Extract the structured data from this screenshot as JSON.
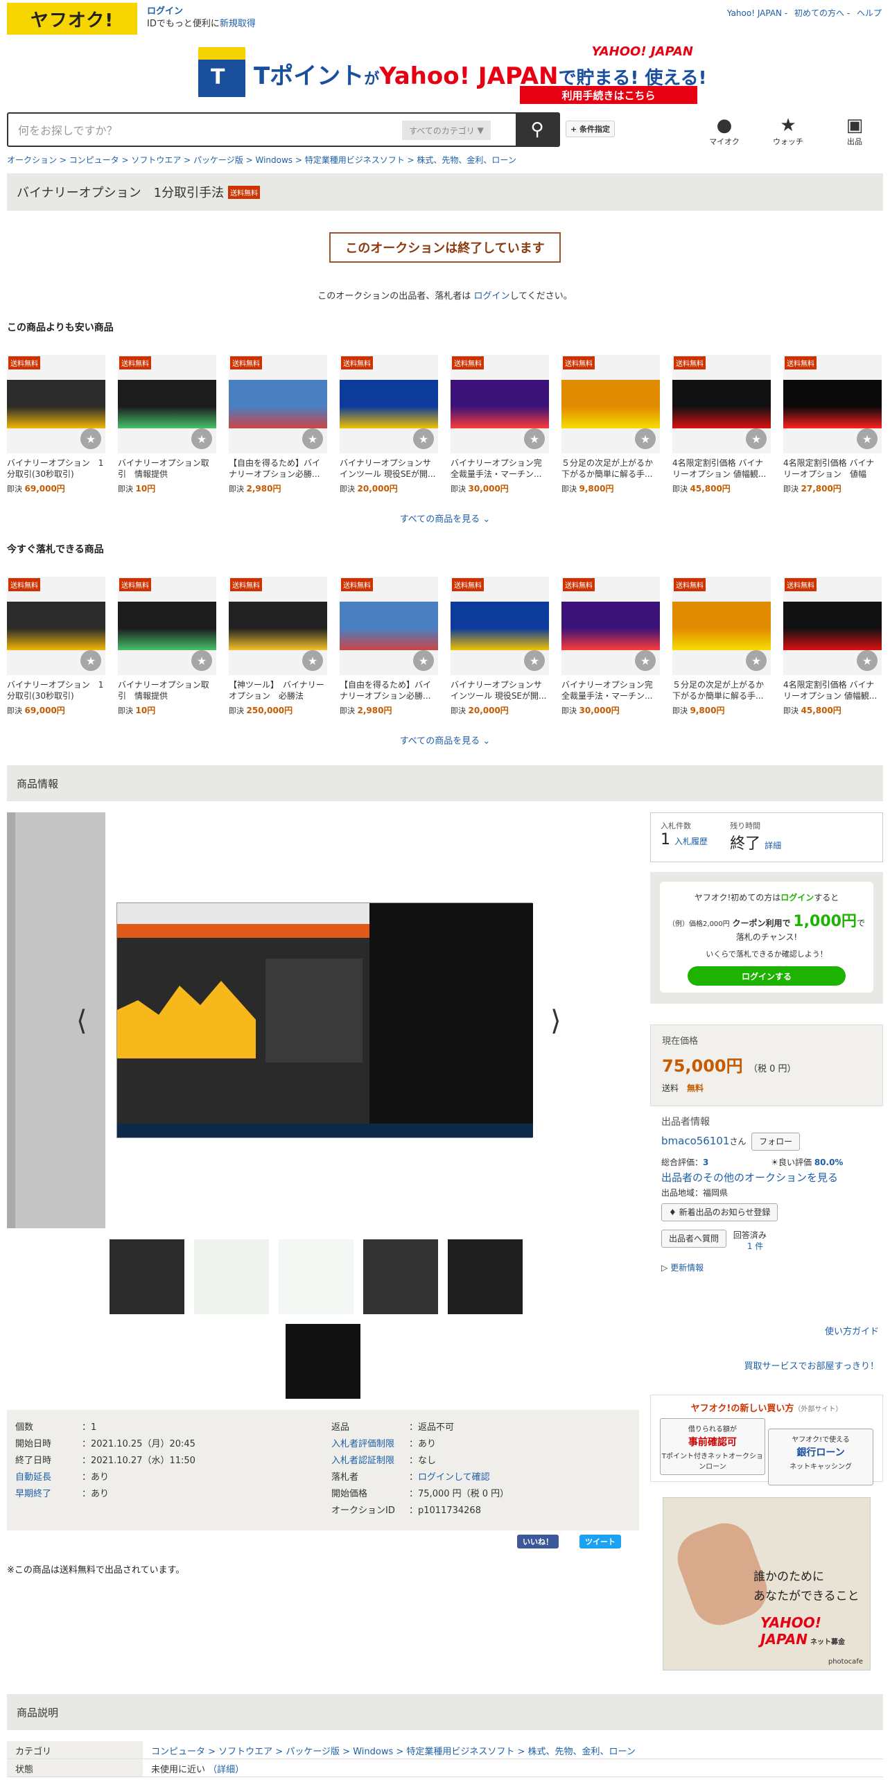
{
  "header": {
    "logo": "ヤフオク!",
    "login": "ログイン",
    "login_sub_prefix": "IDでもっと便利に",
    "login_sub_link": "新規取得",
    "links": [
      "Yahoo! JAPAN",
      "初めての方へ",
      "ヘルプ"
    ]
  },
  "banner": {
    "t": "T",
    "text_a": "Tポイント",
    "text_b": "が",
    "text_c": "Yahoo! JAPAN",
    "text_d": "で貯まる! 使える!",
    "brand": "YAHOO! JAPAN",
    "cta": "利用手続きはこちら"
  },
  "search": {
    "placeholder": "何をお探しですか？",
    "category": "すべてのカテゴリ",
    "condition": "+ 条件指定",
    "nav": [
      "マイオク",
      "ウォッチ",
      "出品"
    ]
  },
  "breadcrumb": "オークション > コンピュータ > ソフトウエア > パッケージ版 > Windows > 特定業種用ビジネスソフト > 株式、先物、金利、ローン",
  "title": "バイナリーオプション　1分取引手法",
  "free_tag": "送料無料",
  "ended": "このオークションは終了しています",
  "ended_note_a": "このオークションの出品者、落札者は",
  "ended_note_link": "ログイン",
  "ended_note_b": "してください。",
  "cheaper": {
    "heading": "この商品よりも安い商品",
    "see_all": "すべての商品を見る",
    "items": [
      {
        "name": "バイナリーオプション　1分取引(30秒取引)",
        "price": "69,000円",
        "color": "#2b2b2b",
        "accent": "#f2b705"
      },
      {
        "name": "バイナリーオプション取引　情報提供",
        "price": "10円",
        "color": "#1c1c1c",
        "accent": "#47c16a"
      },
      {
        "name": "【自由を得るため】バイナリーオプション必勝...",
        "price": "2,980円",
        "color": "#4a7fc1",
        "accent": "#c44"
      },
      {
        "name": "バイナリーオプションサインツール 現役SEが開...",
        "price": "20,000円",
        "color": "#0d3b9c",
        "accent": "#f2c200"
      },
      {
        "name": "バイナリーオプション完全裁量手法・マーチン...",
        "price": "30,000円",
        "color": "#3b1378",
        "accent": "#ff3b3b"
      },
      {
        "name": "５分足の次足が上がるか下がるか簡単に解る手...",
        "price": "9,800円",
        "color": "#e18c00",
        "accent": "#f7dc00"
      },
      {
        "name": "4名限定割引価格 バイナリーオプション 値幅観...",
        "price": "45,800円",
        "color": "#111",
        "accent": "#d11"
      },
      {
        "name": "4名限定割引価格 バイナリーオプション　値幅観...",
        "price": "27,800円",
        "color": "#0a0a0a",
        "accent": "#ff2020"
      }
    ]
  },
  "buynow": {
    "heading": "今すぐ落札できる商品",
    "see_all": "すべての商品を見る",
    "items": [
      {
        "name": "バイナリーオプション　1分取引(30秒取引)",
        "price": "69,000円",
        "color": "#2b2b2b",
        "accent": "#f2b705"
      },
      {
        "name": "バイナリーオプション取引　情報提供",
        "price": "10円",
        "color": "#1c1c1c",
        "accent": "#47c16a"
      },
      {
        "name": "【神ツール】　バイナリーオプション　必勝法",
        "price": "250,000円",
        "color": "#222",
        "accent": "#f6c22a"
      },
      {
        "name": "【自由を得るため】バイナリーオプション必勝...",
        "price": "2,980円",
        "color": "#4a7fc1",
        "accent": "#c44"
      },
      {
        "name": "バイナリーオプションサインツール 現役SEが開...",
        "price": "20,000円",
        "color": "#0d3b9c",
        "accent": "#f2c200"
      },
      {
        "name": "バイナリーオプション完全裁量手法・マーチン...",
        "price": "30,000円",
        "color": "#3b1378",
        "accent": "#ff3b3b"
      },
      {
        "name": "５分足の次足が上がるか下がるか簡単に解る手...",
        "price": "9,800円",
        "color": "#e18c00",
        "accent": "#f7dc00"
      },
      {
        "name": "4名限定割引価格 バイナリーオプション 値幅観...",
        "price": "45,800円",
        "color": "#111",
        "accent": "#d11"
      }
    ]
  },
  "price_prefix": "即決",
  "product_info": "商品情報",
  "bid": {
    "count_label": "入札件数",
    "count": "1",
    "history": "入札履歴",
    "time_label": "残り時間",
    "time": "終了",
    "detail": "詳細"
  },
  "promo": {
    "line1_a": "ヤフオク!初めての方は",
    "line1_link": "ログイン",
    "line1_b": "すると",
    "example": "（例）価格2,000円",
    "coupon": "クーポン利用で",
    "amount": "1,000円",
    "line2": "で落札のチャンス!",
    "line3": "いくらで落札できるか確認しよう！",
    "button": "ログインする"
  },
  "price": {
    "label": "現在価格",
    "amount": "75,000円",
    "tax": "（税 0 円）",
    "ship_label": "送料",
    "ship": "無料"
  },
  "seller": {
    "heading": "出品者情報",
    "name": "bmaco56101",
    "san": "さん",
    "follow": "フォロー",
    "rating_label": "総合評価：",
    "rating": "3",
    "good_label": "良い評価",
    "good": "80.0%",
    "others": "出品者のその他のオークションを見る",
    "region": "出品地域：福岡県",
    "notify": "新着出品のお知らせ登録",
    "question": "出品者へ質問",
    "answered": "回答済み",
    "answered_count": "1 件",
    "update": "更新情報"
  },
  "guide": "使い方ガイド",
  "service": "買取サービスでお部屋すっきり！",
  "newway": {
    "title": "ヤフオク!の新しい買い方",
    "title_sub": "（外部サイト）",
    "b1_top": "借りられる額が",
    "b1_main": "事前確認可",
    "b1_sub": "Tポイント付きネットオークションローン",
    "b2_top": "ヤフオク!で使える",
    "b2_main": "銀行ローン",
    "b2_sub": "ネットキャッシング"
  },
  "ad": {
    "line1": "誰かのために",
    "line2": "あなたができること",
    "brand": "YAHOO! JAPAN",
    "brand_sub": "ネット募金",
    "credit": "photocafe"
  },
  "details_left": [
    {
      "k": "個数",
      "v": "1",
      "link": false
    },
    {
      "k": "開始日時",
      "v": "2021.10.25（月）20:45",
      "link": false
    },
    {
      "k": "終了日時",
      "v": "2021.10.27（水）11:50",
      "link": false
    },
    {
      "k": "自動延長",
      "v": "あり",
      "link": true
    },
    {
      "k": "早期終了",
      "v": "あり",
      "link": true
    }
  ],
  "details_right": [
    {
      "k": "返品",
      "v": "返品不可",
      "link": false
    },
    {
      "k": "入札者評価制限",
      "v": "あり",
      "link": true
    },
    {
      "k": "入札者認証制限",
      "v": "なし",
      "link": true
    },
    {
      "k": "落札者",
      "v": "ログインして確認",
      "link": false
    },
    {
      "k": "開始価格",
      "v": "75,000 円（税 0 円）",
      "link": false
    },
    {
      "k": "オークションID",
      "v": "p1011734268",
      "link": false
    }
  ],
  "share": {
    "like": "いいね！",
    "tweet": "ツイート"
  },
  "free_note": "※この商品は送料無料で出品されています。",
  "description": "商品説明",
  "category": {
    "label": "カテゴリ",
    "value": "コンピュータ > ソフトウエア > パッケージ版 > Windows > 特定業種用ビジネスソフト > 株式、先物、金利、ローン",
    "state_label": "状態",
    "state": "未使用に近い",
    "state_detail": "（詳細）"
  }
}
